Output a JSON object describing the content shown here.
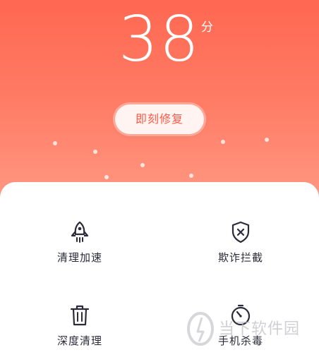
{
  "header": {
    "score": "38",
    "score_unit": "分",
    "fix_button_label": "即刻修复"
  },
  "features": [
    {
      "label": "清理加速",
      "icon": "rocket-icon"
    },
    {
      "label": "欺诈拦截",
      "icon": "shield-x-icon"
    },
    {
      "label": "深度清理",
      "icon": "trash-icon"
    },
    {
      "label": "手机杀毒",
      "icon": "timer-icon"
    }
  ],
  "watermark": {
    "text": "当下软件园"
  },
  "colors": {
    "accent": "#ff6852",
    "button_text": "#ff5a45",
    "label_text": "#2b2b3a"
  }
}
